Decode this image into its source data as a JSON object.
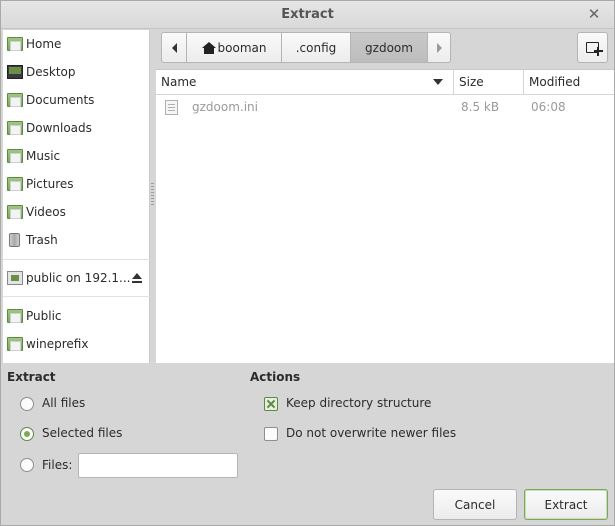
{
  "window": {
    "title": "Extract"
  },
  "sidebar": {
    "items": [
      {
        "label": "Home",
        "icon": "home-folder-icon"
      },
      {
        "label": "Desktop",
        "icon": "desktop-icon"
      },
      {
        "label": "Documents",
        "icon": "documents-folder-icon"
      },
      {
        "label": "Downloads",
        "icon": "downloads-folder-icon"
      },
      {
        "label": "Music",
        "icon": "music-folder-icon"
      },
      {
        "label": "Pictures",
        "icon": "pictures-folder-icon"
      },
      {
        "label": "Videos",
        "icon": "videos-folder-icon"
      },
      {
        "label": "Trash",
        "icon": "trash-icon"
      }
    ],
    "network": [
      {
        "label": "public on 192.1...",
        "icon": "network-drive-icon"
      }
    ],
    "bookmarks": [
      {
        "label": "Public",
        "icon": "folder-icon"
      },
      {
        "label": "wineprefix",
        "icon": "folder-icon"
      }
    ]
  },
  "pathbar": {
    "segments": [
      "booman",
      ".config",
      "gzdoom"
    ],
    "active": "gzdoom"
  },
  "filelist": {
    "columns": {
      "name": "Name",
      "size": "Size",
      "modified": "Modified"
    },
    "rows": [
      {
        "name": "gzdoom.ini",
        "size": "8.5 kB",
        "modified": "06:08"
      }
    ]
  },
  "extract": {
    "title": "Extract",
    "options": [
      {
        "label": "All files",
        "checked": false
      },
      {
        "label": "Selected files",
        "checked": true
      },
      {
        "label": "Files:",
        "checked": false
      }
    ],
    "files_value": ""
  },
  "actions": {
    "title": "Actions",
    "options": [
      {
        "label": "Keep directory structure",
        "checked": true
      },
      {
        "label": "Do not overwrite newer files",
        "checked": false
      }
    ]
  },
  "buttons": {
    "cancel": "Cancel",
    "extract": "Extract"
  },
  "colors": {
    "accent": "#7aa95a",
    "window_bg": "#d6d6d6"
  }
}
